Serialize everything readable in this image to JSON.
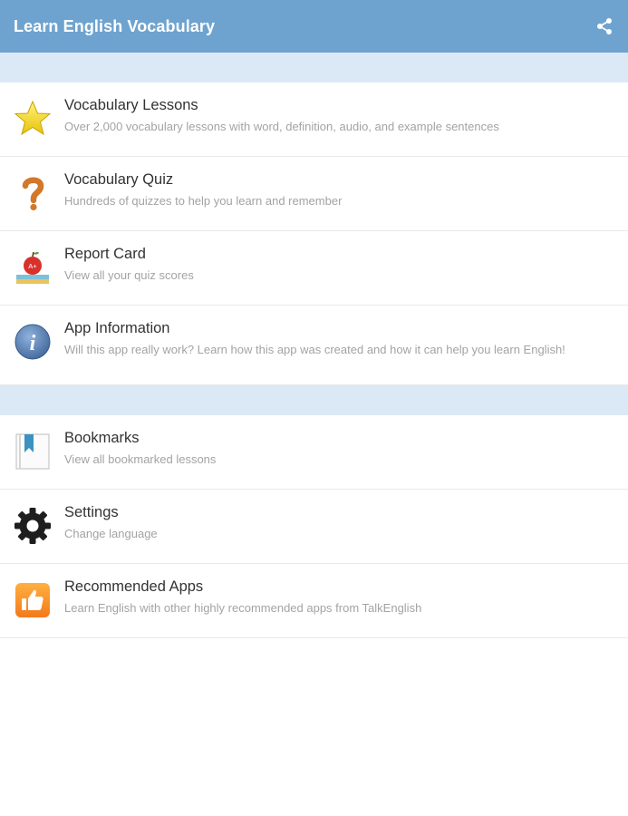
{
  "appbar": {
    "title": "Learn English Vocabulary",
    "share_icon": "share-icon",
    "color": "#6ea3cf"
  },
  "section_color": "#dbe9f6",
  "sections": [
    {
      "items": [
        {
          "icon": "star-icon",
          "title": "Vocabulary Lessons",
          "subtitle": "Over 2,000 vocabulary lessons with word, definition, audio, and example sentences"
        },
        {
          "icon": "question-mark-icon",
          "title": "Vocabulary Quiz",
          "subtitle": "Hundreds of quizzes to help you learn and remember"
        },
        {
          "icon": "apple-books-icon",
          "title": "Report Card",
          "subtitle": "View all your quiz scores",
          "icon_text": "A+"
        },
        {
          "icon": "info-icon",
          "title": "App Information",
          "subtitle": "Will this app really work? Learn how this app was created and how it can help you learn English!"
        }
      ]
    },
    {
      "items": [
        {
          "icon": "bookmark-icon",
          "title": "Bookmarks",
          "subtitle": "View all bookmarked lessons"
        },
        {
          "icon": "gear-icon",
          "title": "Settings",
          "subtitle": "Change language"
        },
        {
          "icon": "thumbs-up-icon",
          "title": "Recommended Apps",
          "subtitle": "Learn English with other highly recommended apps from TalkEnglish"
        }
      ]
    }
  ]
}
